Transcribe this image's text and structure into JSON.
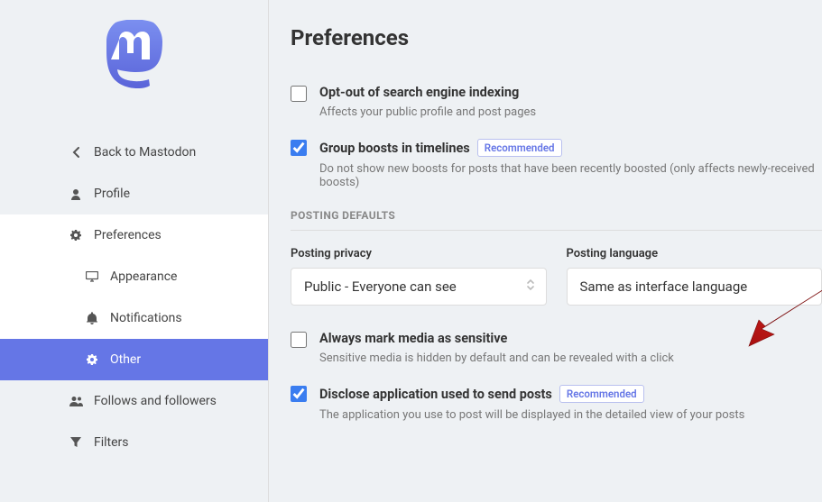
{
  "sidebar": {
    "back": "Back to Mastodon",
    "profile": "Profile",
    "preferences": "Preferences",
    "appearance": "Appearance",
    "notifications": "Notifications",
    "other": "Other",
    "follows": "Follows and followers",
    "filters": "Filters"
  },
  "page": {
    "title": "Preferences",
    "section_posting_defaults": "POSTING DEFAULTS"
  },
  "opts": {
    "optout": {
      "title": "Opt-out of search engine indexing",
      "desc": "Affects your public profile and post pages",
      "checked": false
    },
    "group_boosts": {
      "title": "Group boosts in timelines",
      "badge": "Recommended",
      "desc": "Do not show new boosts for posts that have been recently boosted (only affects newly-received boosts)",
      "checked": true
    },
    "sensitive": {
      "title": "Always mark media as sensitive",
      "desc": "Sensitive media is hidden by default and can be revealed with a click",
      "checked": false
    },
    "disclose": {
      "title": "Disclose application used to send posts",
      "badge": "Recommended",
      "desc": "The application you use to post will be displayed in the detailed view of your posts",
      "checked": true
    }
  },
  "fields": {
    "privacy": {
      "label": "Posting privacy",
      "value": "Public - Everyone can see"
    },
    "language": {
      "label": "Posting language",
      "value": "Same as interface language"
    }
  }
}
